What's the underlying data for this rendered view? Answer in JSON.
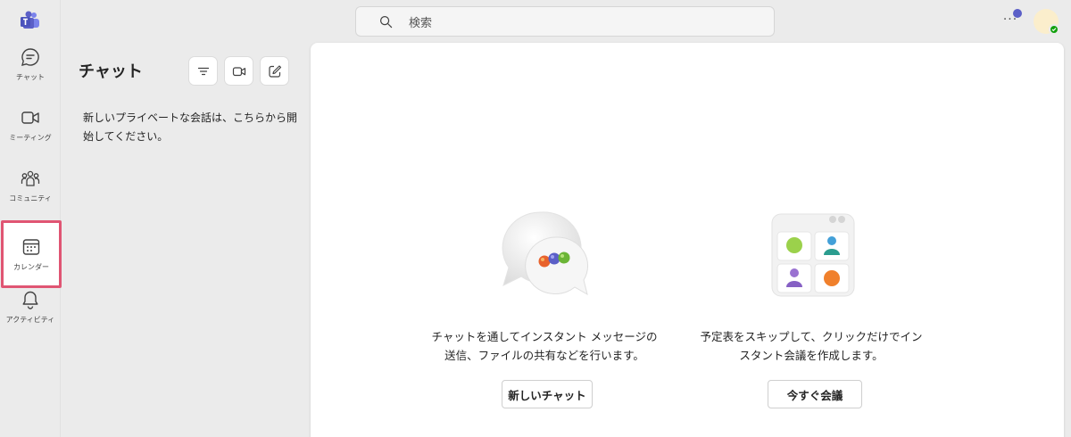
{
  "rail": {
    "items": [
      {
        "label": "チャット",
        "icon": "chat-icon"
      },
      {
        "label": "ミーティング",
        "icon": "video-icon"
      },
      {
        "label": "コミュニティ",
        "icon": "people-icon"
      },
      {
        "label": "カレンダー",
        "icon": "calendar-icon",
        "active": true
      },
      {
        "label": "アクティビティ",
        "icon": "bell-icon"
      }
    ]
  },
  "search": {
    "placeholder": "検索"
  },
  "chat_pane": {
    "title": "チャット",
    "empty_message": "新しいプライベートな会話は、こちらから開始してください。"
  },
  "main": {
    "chat_card": {
      "description": "チャットを通してインスタント メッセージの送信、ファイルの共有などを行います。",
      "button_label": "新しいチャット"
    },
    "meet_card": {
      "description": "予定表をスキップして、クリックだけでインスタント会議を作成します。",
      "button_label": "今すぐ会議"
    }
  },
  "colors": {
    "accent": "#5b5fc7",
    "highlight_border": "#e05573",
    "presence": "#13a10e"
  }
}
